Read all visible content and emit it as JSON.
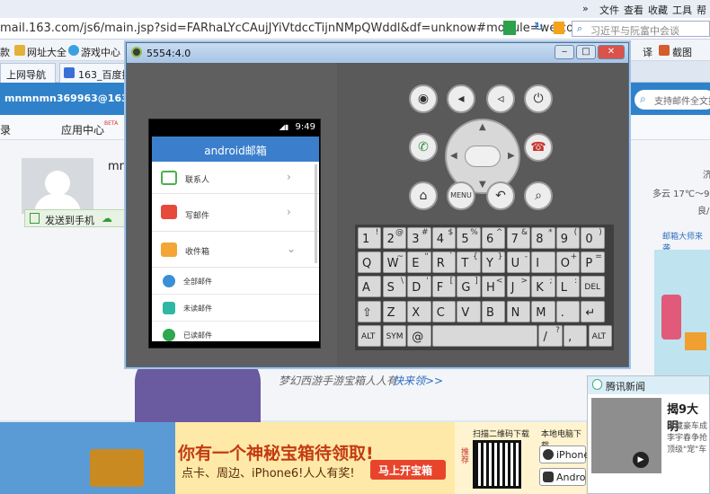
{
  "browser": {
    "menu": [
      "文件",
      "查看",
      "收藏",
      "工具",
      "帮助"
    ],
    "menu_arrow": "»",
    "url": "mail.163.com/js6/main.jsp?sid=FARhaLYcCAujJYiVtdccTijnNMpQWddl&df=unknow#module=welco",
    "search_placeholder": "习近平与阮富中会谈",
    "favorites": [
      "款",
      "网址大全",
      "游戏中心"
    ],
    "fav_right": [
      "译",
      "截图"
    ],
    "tabs": [
      "上网导航",
      "163_百度搜索"
    ]
  },
  "mail": {
    "account": "mnmnmn369963@163.com",
    "nav": [
      "录",
      "应用中心"
    ],
    "nav_badge": "BETA",
    "user_partial": "mn",
    "send_to_phone": "发送到手机",
    "search_placeholder": "支持邮件全文搜",
    "weather": [
      "济",
      "多云 17℃～9",
      "良/"
    ],
    "ad_link": "邮箱大师来袭",
    "promo_text": "梦幻西游手游宝箱人人有",
    "promo_link": "快来领>>"
  },
  "banner": {
    "title": "你有一个神秘宝箱待领取!",
    "subtitle": "点卡、周边、iPhone6!人人有奖!",
    "button": "马上开宝箱",
    "qr_label": "扫描二维码下载",
    "qr_side": "推荐",
    "local": "本地电脑下载",
    "iphone": "iPhone",
    "android": "Andro"
  },
  "news": {
    "title": "腾讯新闻",
    "headline": "揭9大明",
    "body": [
      "收藏豪车成",
      "李宇春争抢",
      "顶级\"宠\"车"
    ]
  },
  "emulator": {
    "title": "5554:4.0",
    "time": "9:49",
    "app_title": "android邮箱",
    "rows": [
      {
        "label": "联系人"
      },
      {
        "label": "写邮件"
      },
      {
        "label": "收件箱"
      }
    ],
    "subrows": [
      "全部邮件",
      "未读邮件",
      "已读邮件"
    ],
    "menu_key": "MENU",
    "keyboard": [
      [
        [
          "1",
          "!"
        ],
        [
          "2",
          "@"
        ],
        [
          "3",
          "#"
        ],
        [
          "4",
          "$"
        ],
        [
          "5",
          "%"
        ],
        [
          "6",
          "^"
        ],
        [
          "7",
          "&"
        ],
        [
          "8",
          "*"
        ],
        [
          "9",
          "("
        ],
        [
          "0",
          ")"
        ]
      ],
      [
        [
          "Q",
          ""
        ],
        [
          "W",
          "~"
        ],
        [
          "E",
          "\""
        ],
        [
          "R",
          "`"
        ],
        [
          "T",
          "{"
        ],
        [
          "Y",
          "}"
        ],
        [
          "U",
          "-"
        ],
        [
          "I",
          ""
        ],
        [
          "O",
          "+"
        ],
        [
          "P",
          "="
        ]
      ],
      [
        [
          "A",
          ""
        ],
        [
          "S",
          "\\"
        ],
        [
          "D",
          "'"
        ],
        [
          "F",
          "["
        ],
        [
          "G",
          "]"
        ],
        [
          "H",
          "<"
        ],
        [
          "J",
          ">"
        ],
        [
          "K",
          ";"
        ],
        [
          "L",
          ":"
        ],
        [
          "DEL",
          ""
        ]
      ],
      [
        [
          "⇧",
          ""
        ],
        [
          "Z",
          ""
        ],
        [
          "X",
          ""
        ],
        [
          "C",
          ""
        ],
        [
          "V",
          ""
        ],
        [
          "B",
          ""
        ],
        [
          "N",
          ""
        ],
        [
          "M",
          ""
        ],
        [
          ".",
          ""
        ],
        [
          "↵",
          ""
        ]
      ],
      [
        [
          "ALT",
          ""
        ],
        [
          "SYM",
          ""
        ],
        [
          "@",
          ""
        ],
        [
          "␣",
          ""
        ],
        [
          "/",
          "?"
        ],
        [
          ",",
          ""
        ],
        [
          "ALT",
          ""
        ]
      ]
    ]
  },
  "colors": {
    "mail_header": "#2f82c9",
    "app_bar": "#3b7fcc",
    "banner_bg": "#ffe9a8",
    "call_green": "#2f8a3c",
    "end_red": "#c8322a"
  }
}
